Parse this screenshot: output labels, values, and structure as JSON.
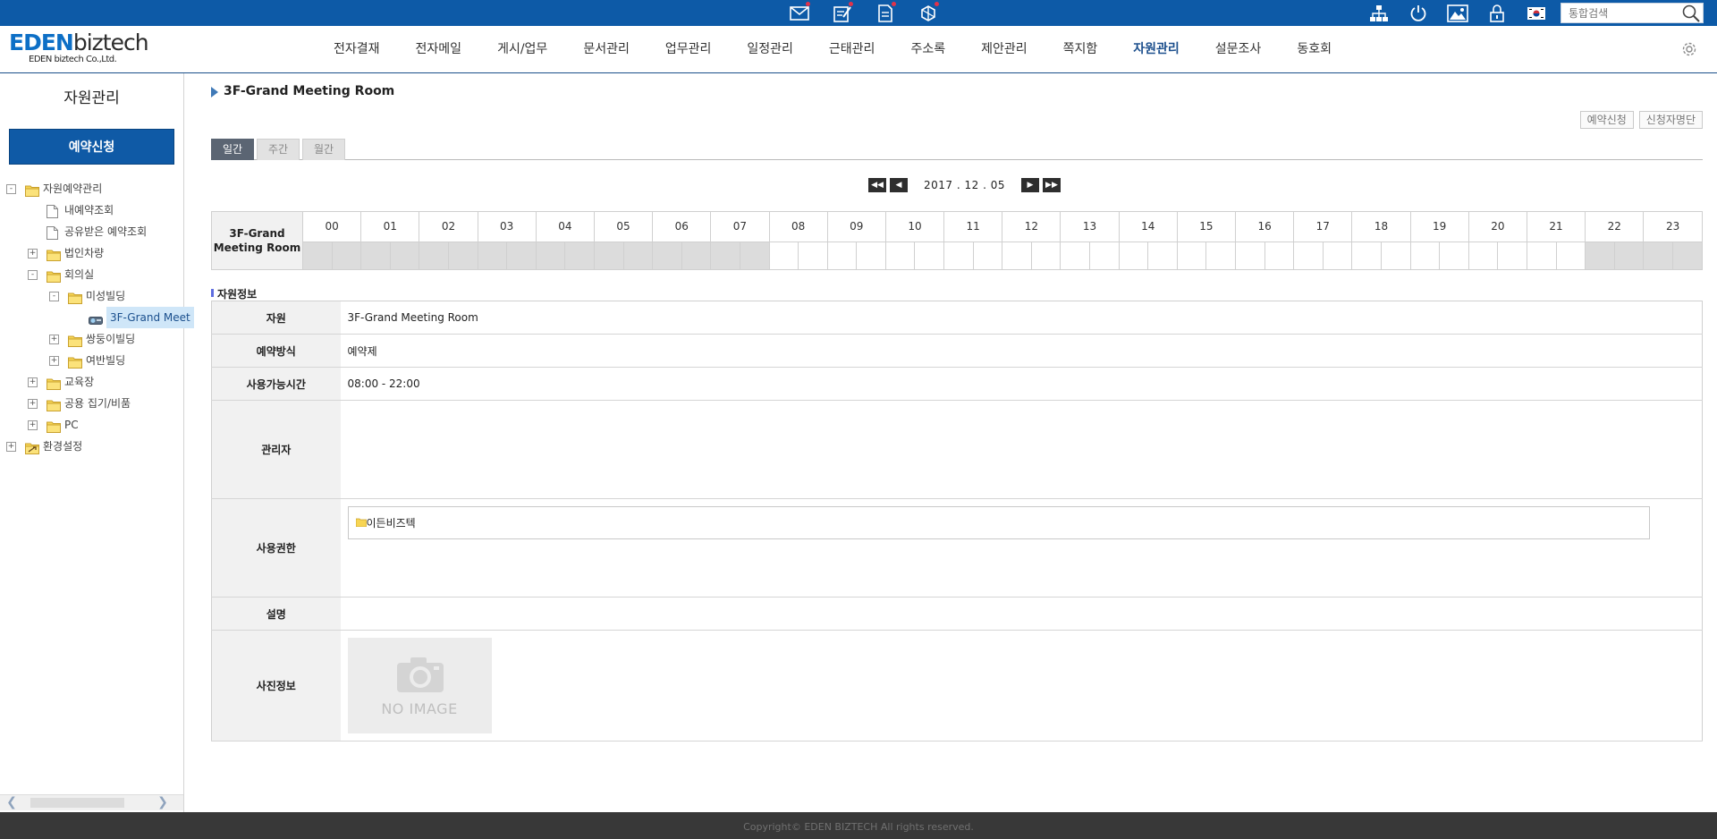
{
  "topbar": {
    "quick_icons": [
      "mail-icon",
      "approval-icon",
      "document-icon",
      "task-icon"
    ],
    "right_icons": [
      "orgchart-icon",
      "power-icon",
      "image-icon",
      "lock-icon",
      "korea-flag-icon"
    ],
    "search_placeholder": "통합검색"
  },
  "logo": {
    "brand_e": "EDEN",
    "brand_b": "biztech",
    "sub": "EDEN biztech Co.,Ltd."
  },
  "gnb": [
    "전자결재",
    "전자메일",
    "게시/업무",
    "문서관리",
    "업무관리",
    "일정관리",
    "근태관리",
    "주소록",
    "제안관리",
    "쪽지함",
    "자원관리",
    "설문조사",
    "동호회"
  ],
  "gnb_active": "자원관리",
  "sidebar": {
    "title": "자원관리",
    "reserve_button": "예약신청",
    "tree": [
      {
        "label": "자원예약관리",
        "level": 0,
        "toggle": "-",
        "icon": "folder"
      },
      {
        "label": "내예약조회",
        "level": 1,
        "toggle": "",
        "icon": "page"
      },
      {
        "label": "공유받은 예약조회",
        "level": 1,
        "toggle": "",
        "icon": "page"
      },
      {
        "label": "법인차량",
        "level": 1,
        "toggle": "+",
        "icon": "folder"
      },
      {
        "label": "회의실",
        "level": 1,
        "toggle": "-",
        "icon": "folder"
      },
      {
        "label": "미성빌딩",
        "level": 2,
        "toggle": "-",
        "icon": "folder"
      },
      {
        "label": "3F-Grand Meet",
        "level": 3,
        "toggle": "",
        "icon": "projector",
        "selected": true
      },
      {
        "label": "쌍둥이빌딩",
        "level": 2,
        "toggle": "+",
        "icon": "folder"
      },
      {
        "label": "여반빌딩",
        "level": 2,
        "toggle": "+",
        "icon": "folder"
      },
      {
        "label": "교육장",
        "level": 1,
        "toggle": "+",
        "icon": "folder"
      },
      {
        "label": "공용 집기/비품",
        "level": 1,
        "toggle": "+",
        "icon": "folder"
      },
      {
        "label": "PC",
        "level": 1,
        "toggle": "+",
        "icon": "folder"
      },
      {
        "label": "환경설정",
        "level": 0,
        "toggle": "+",
        "icon": "settings-folder"
      }
    ]
  },
  "main": {
    "title": "3F-Grand Meeting Room",
    "btn_reserve": "예약신청",
    "btn_applicants": "신청자명단",
    "tabs": [
      "일간",
      "주간",
      "월간"
    ],
    "active_tab": "일간",
    "date": "2017 . 12 . 05"
  },
  "schedule": {
    "resource_line1": "3F-Grand",
    "resource_line2": "Meeting Room",
    "hours": [
      "00",
      "01",
      "02",
      "03",
      "04",
      "05",
      "06",
      "07",
      "08",
      "09",
      "10",
      "11",
      "12",
      "13",
      "14",
      "15",
      "16",
      "17",
      "18",
      "19",
      "20",
      "21",
      "22",
      "23"
    ],
    "available_from_hour": 8,
    "available_to_hour": 22
  },
  "info": {
    "section_title": "자원정보",
    "rows": {
      "resource_label": "자원",
      "resource_value": "3F-Grand Meeting Room",
      "method_label": "예약방식",
      "method_value": "예약제",
      "hours_label": "사용가능시간",
      "hours_value": "08:00 - 22:00",
      "manager_label": "관리자",
      "manager_value": "",
      "perm_label": "사용권한",
      "perm_value": "이든비즈텍",
      "desc_label": "설명",
      "desc_value": "",
      "photo_label": "사진정보",
      "photo_placeholder": "NO IMAGE"
    }
  },
  "footer": {
    "copyright": "Copyright© EDEN BIZTECH All rights reserved."
  }
}
